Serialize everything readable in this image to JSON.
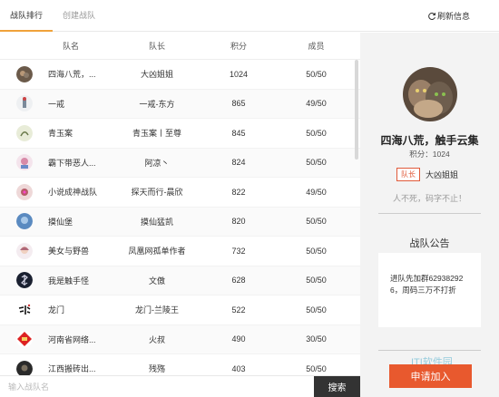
{
  "tabs": [
    {
      "label": "战队排行",
      "active": true
    },
    {
      "label": "创建战队",
      "active": false
    }
  ],
  "refresh_label": "刷新信息",
  "table": {
    "headers": [
      "队名",
      "队长",
      "积分",
      "成员"
    ],
    "rows": [
      {
        "name": "四海八荒，...",
        "leader": "大凶姐姐",
        "points": "1024",
        "members": "50/50",
        "avatar": "cat-avatar"
      },
      {
        "name": "一戒",
        "leader": "一戒-东方",
        "points": "865",
        "members": "49/50",
        "avatar": "figure-avatar"
      },
      {
        "name": "青玉案",
        "leader": "青玉案丨至尊",
        "points": "845",
        "members": "50/50",
        "avatar": "ink-avatar"
      },
      {
        "name": "霸下带恶人...",
        "leader": "阿凉丶",
        "points": "824",
        "members": "50/50",
        "avatar": "anime-avatar"
      },
      {
        "name": "小说成神战队",
        "leader": "探天而行-晨欣",
        "points": "822",
        "members": "49/50",
        "avatar": "flower-avatar"
      },
      {
        "name": "摸仙堡",
        "leader": "摸仙猛凯",
        "points": "820",
        "members": "50/50",
        "avatar": "blue-avatar"
      },
      {
        "name": "美女与野兽",
        "leader": "凤凰网孤单作者",
        "points": "732",
        "members": "50/50",
        "avatar": "girl-avatar"
      },
      {
        "name": "我是触手怪",
        "leader": "文傲",
        "points": "628",
        "members": "50/50",
        "avatar": "dark-logo-avatar"
      },
      {
        "name": "龙门",
        "leader": "龙门-兰陵王",
        "points": "522",
        "members": "50/50",
        "avatar": "calligraphy-avatar"
      },
      {
        "name": "河南省网络...",
        "leader": "火叔",
        "points": "490",
        "members": "30/50",
        "avatar": "red-diamond-avatar"
      },
      {
        "name": "江西搬砖出...",
        "leader": "残殇",
        "points": "403",
        "members": "50/50",
        "avatar": "dark-avatar"
      }
    ]
  },
  "search": {
    "placeholder": "输入战队名",
    "button_label": "搜索"
  },
  "detail": {
    "team_name": "四海八荒，触手云集",
    "points_text": "积分：1024",
    "leader_badge": "队长",
    "leader_name": "大凶姐姐",
    "motto": "人不死，码字不止！",
    "notice_title": "战队公告",
    "notice_text": "进队先加群629382926，周码三万不打折",
    "apply_label": "申请加入",
    "watermark": "ITI软件园"
  },
  "colors": {
    "accent_tab": "#f0a23a",
    "apply": "#e8592e",
    "search_btn": "#333333",
    "badge": "#e05a3a"
  }
}
